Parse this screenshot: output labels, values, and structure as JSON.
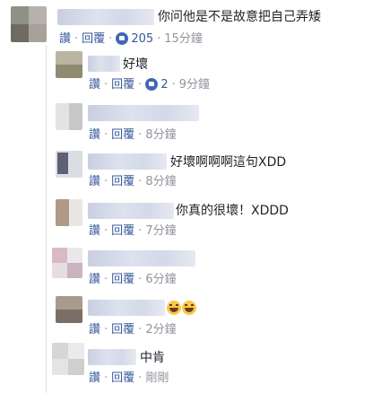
{
  "thread": {
    "top_comment": {
      "text": "你问他是不是故意把自己弄矮",
      "like_label": "讚",
      "reply_label": "回覆",
      "reaction_count": "205",
      "time": "15分鐘"
    },
    "replies": [
      {
        "text": "好壞",
        "like_label": "讚",
        "reply_label": "回覆",
        "reaction_count": "2",
        "time": "9分鐘"
      },
      {
        "text": "",
        "like_label": "讚",
        "reply_label": "回覆",
        "time": "8分鐘"
      },
      {
        "text": "好壞啊啊啊這句XDD",
        "like_label": "讚",
        "reply_label": "回覆",
        "time": "8分鐘"
      },
      {
        "text": "你真的很壞！XDDD",
        "like_label": "讚",
        "reply_label": "回覆",
        "time": "7分鐘"
      },
      {
        "text": "",
        "like_label": "讚",
        "reply_label": "回覆",
        "time": "6分鐘"
      },
      {
        "text": "",
        "like_label": "讚",
        "reply_label": "回覆",
        "time": "2分鐘",
        "emoji": "laughing-tears-emoji"
      },
      {
        "text": "中肯",
        "like_label": "讚",
        "reply_label": "回覆",
        "time": "剛剛"
      }
    ]
  },
  "colors": {
    "link": "#385898",
    "meta": "#90949c",
    "like_badge": "#4267b2"
  }
}
